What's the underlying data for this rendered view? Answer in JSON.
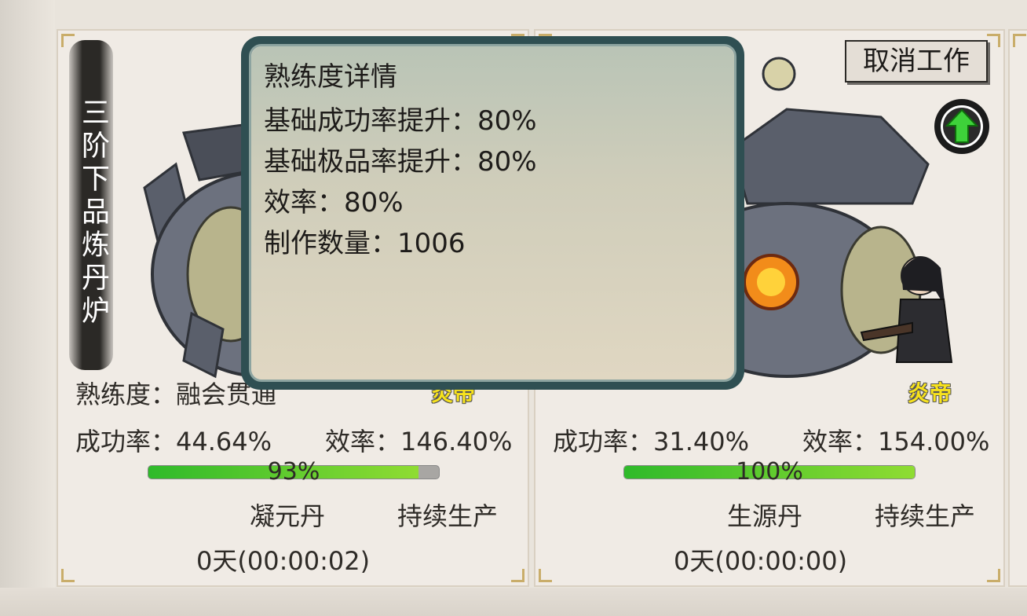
{
  "card1": {
    "vertical_title": "三阶下品炼丹炉",
    "proficiency_label": "熟练度",
    "proficiency_value": "融会贯通",
    "char_name": "炎帝",
    "success_rate": "成功率：44.64%",
    "efficiency": "效率：146.40%",
    "progress_text": "93%",
    "progress_value": 0.93,
    "product": "凝元丹",
    "mode": "持续生产",
    "timer": "0天(00:00:02)"
  },
  "card2": {
    "char_name": "炎帝",
    "success_rate": "成功率：31.40%",
    "efficiency": "效率：154.00%",
    "progress_text": "100%",
    "progress_value": 1.0,
    "product": "生源丹",
    "mode": "持续生产",
    "timer": "0天(00:00:00)",
    "cancel_label": "取消工作"
  },
  "popup": {
    "title": "熟练度详情",
    "lines": [
      "基础成功率提升：80%",
      "基础极品率提升：80%",
      "效率：80%",
      "制作数量：1006"
    ]
  },
  "colors": {
    "progress_green": "#2fba2a",
    "char_name_yellow": "#f7e21d",
    "popup_border": "#2f4f52"
  },
  "icons": [
    "furnace-image",
    "character-sprite",
    "upgrade-arrow-icon"
  ]
}
